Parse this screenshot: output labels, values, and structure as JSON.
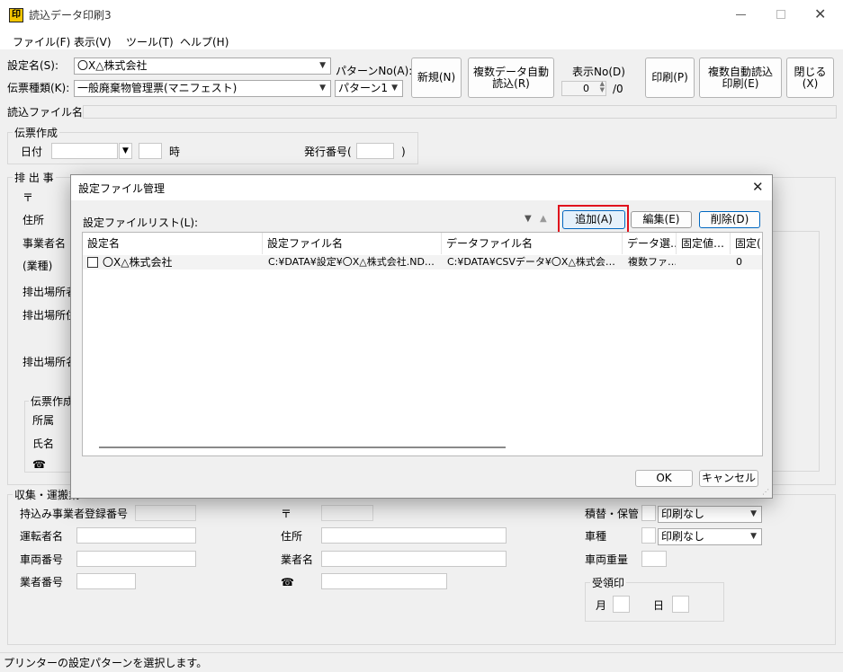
{
  "window": {
    "title": "読込データ印刷3",
    "app_icon": "印"
  },
  "menu": [
    "ファイル(F)",
    "表示(V)",
    "ツール(T)",
    "ヘルプ(H)"
  ],
  "top": {
    "setting_name_label": "設定名(S):",
    "setting_name_value": "〇X△株式会社",
    "slip_type_label": "伝票種類(K):",
    "slip_type_value": "一般廃棄物管理票(マニフェスト)",
    "pattern_label": "パターンNo(A):",
    "pattern_value": "パターン1",
    "new_button": "新規(N)",
    "multi_auto_read_button": "複数データ自動\n読込(R)",
    "display_no_label": "表示No(D)",
    "display_no_value": "0",
    "display_no_total": "/0",
    "print_button": "印刷(P)",
    "multi_auto_print_button": "複数自動読込\n印刷(E)",
    "close_button": "閉じる(X)",
    "read_file_label": "読込ファイル名"
  },
  "slip": {
    "group_label": "伝票作成",
    "date_label": "日付",
    "hour_label": "時",
    "issue_no_label": "発行番号(",
    "issue_no_close": ")"
  },
  "emitter": {
    "group_label": "排 出 事",
    "postal_symbol": "〒",
    "address_label": "住所",
    "business_name_label": "事業者名",
    "industry_label": "(業種)",
    "site_label_1": "排出場所者",
    "site_label_2": "排出場所住",
    "site_label_3": "排出場所名",
    "creator_group_label": "伝票作成",
    "dept_label": "所属",
    "person_label": "氏名",
    "phone_symbol": "☎"
  },
  "transport": {
    "group_label": "収集・運搬業",
    "registration_no_label": "持込み事業者登録番号",
    "driver_label": "運転者名",
    "vehicle_no_label": "車両番号",
    "business_no_label": "業者番号",
    "postal_symbol": "〒",
    "address_label": "住所",
    "business_name_label": "業者名",
    "phone_symbol": "☎",
    "storage_label": "積替・保管",
    "storage_value": "印刷なし",
    "vehicle_type_label": "車種",
    "vehicle_type_value": "印刷なし",
    "vehicle_weight_label": "車両重量",
    "receipt_group_label": "受領印",
    "month_label": "月",
    "day_label": "日"
  },
  "modal": {
    "title": "設定ファイル管理",
    "list_label": "設定ファイルリスト(L):",
    "add_button": "追加(A)",
    "edit_button": "編集(E)",
    "delete_button": "削除(D)",
    "columns": [
      "設定名",
      "設定ファイル名",
      "データファイル名",
      "データ選…",
      "固定値…",
      "固定("
    ],
    "rows": [
      [
        "〇X△株式会社",
        "C:¥DATA¥設定¥〇X△株式会社.ND…",
        "C:¥DATA¥CSVデータ¥〇X△株式会…",
        "複数ファ…",
        "",
        "0"
      ]
    ],
    "ok_button": "OK",
    "cancel_button": "キャンセル"
  },
  "status_text": "プリンターの設定パターンを選択します。",
  "colors": {
    "highlight": "#e0101c",
    "accent": "#0067c0"
  }
}
